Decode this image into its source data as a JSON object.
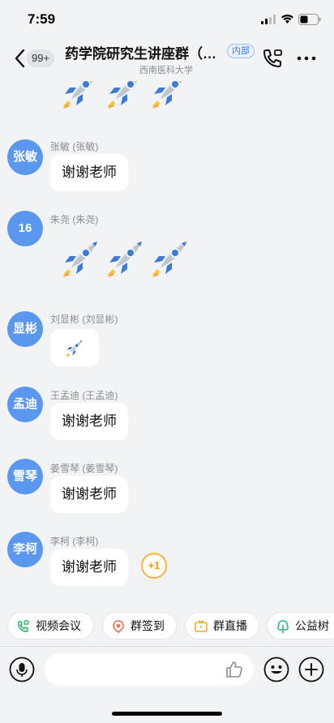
{
  "status_bar": {
    "time": "7:59"
  },
  "header": {
    "unread_count": "99+",
    "title": "药学院研究生讲座群（…",
    "tag": "内部",
    "subtitle": "西南医科大学"
  },
  "messages": [
    {
      "avatar_text": "张敏",
      "sender": "张敏 (张敏)",
      "text": "谢谢老师"
    },
    {
      "avatar_text": "16",
      "sender": "朱尧 (朱尧)"
    },
    {
      "avatar_text": "显彬",
      "sender": "刘显彬 (刘显彬)"
    },
    {
      "avatar_text": "孟迪",
      "sender": "王孟迪 (王孟迪)",
      "text": "谢谢老师"
    },
    {
      "avatar_text": "雪琴",
      "sender": "姜雪琴 (姜雪琴)",
      "text": "谢谢老师"
    },
    {
      "avatar_text": "李柯",
      "sender": "李柯 (李柯)",
      "text": "谢谢老师"
    }
  ],
  "plus_one": "+1",
  "quick_actions": [
    {
      "label": "视频会议",
      "icon": "video-call-icon"
    },
    {
      "label": "群签到",
      "icon": "checkin-icon"
    },
    {
      "label": "群直播",
      "icon": "live-icon"
    },
    {
      "label": "公益树",
      "icon": "tree-icon"
    }
  ],
  "icons": {
    "back": "back-arrow-icon",
    "call": "phone-icon",
    "more": "more-icon",
    "voice": "microphone-icon",
    "thumb": "thumbs-up-icon",
    "emoji": "emoji-icon",
    "plus": "plus-icon"
  },
  "colors": {
    "avatar": "#5a97ee",
    "internal_tag": "#3b7cff",
    "plus_one": "#ff9d00",
    "background": "#f2f3f5"
  }
}
